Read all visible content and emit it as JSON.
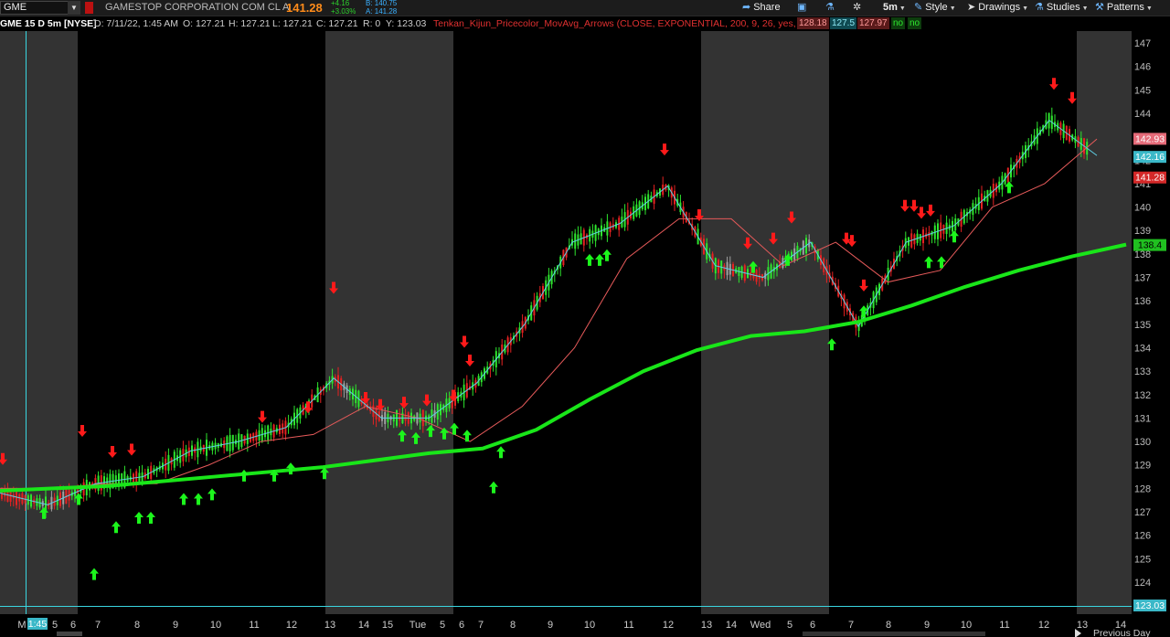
{
  "toolbar": {
    "symbol": "GME",
    "company": "GAMESTOP CORPORATION COM CL A",
    "last_price": "141.28",
    "change_abs": "+4.16",
    "change_pct": "+3.03%",
    "bid": "B: 140.75",
    "ask": "A: 141.28",
    "share_label": "Share",
    "interval_label": "5m",
    "style_label": "Style",
    "drawings_label": "Drawings",
    "studies_label": "Studies",
    "patterns_label": "Patterns"
  },
  "info": {
    "chart_title": "GME 15 D 5m [NYSE]",
    "date": "D: 7/11/22, 1:45 AM",
    "open": "O: 127.21",
    "high": "H: 127.21",
    "low": "L: 127.21",
    "close": "C: 127.21",
    "range": "R: 0",
    "y": "Y: 123.03",
    "study": "Tenkan_Kijun_Pricecolor_MovAvg_Arrows (CLOSE, EXPONENTIAL, 200, 9, 26, yes, yes)",
    "study_val1": "128.18",
    "study_val2": "127.5",
    "study_val3": "127.97",
    "study_flag1": "no",
    "study_flag2": "no"
  },
  "axis": {
    "price_labels": [
      "147",
      "146",
      "145",
      "144",
      "143",
      "142",
      "141",
      "140",
      "139",
      "138",
      "137",
      "136",
      "135",
      "134",
      "133",
      "132",
      "131",
      "130",
      "129",
      "128",
      "127",
      "126",
      "125",
      "124"
    ],
    "tag_kijun": "142.93",
    "tag_tenkan": "142.16",
    "tag_last": "141.28",
    "tag_ma": "138.4",
    "tag_cursor": "123.03",
    "time_labels": [
      "M",
      "1:45",
      "5",
      "6",
      "7",
      "8",
      "9",
      "10",
      "11",
      "12",
      "13",
      "14",
      "15",
      "Tue",
      "5",
      "6",
      "7",
      "8",
      "9",
      "10",
      "11",
      "12",
      "13",
      "14",
      "Wed",
      "5",
      "6",
      "7",
      "8",
      "9",
      "10",
      "11",
      "12",
      "13",
      "14"
    ],
    "time_tail": "Previous Day"
  },
  "colors": {
    "ma": "#19e619",
    "tenkan": "#5fd0e6",
    "kijun": "#e65a5a",
    "up": "#2ee62e",
    "down": "#e62222",
    "neutral": "#a0a0a0",
    "session_shade": "#333333",
    "arrow_up": "#1cf51c",
    "arrow_down": "#ff1a1a"
  },
  "icons": {
    "share": "share-icon",
    "layout": "grid-layout-icon",
    "flask": "flask-icon",
    "settings": "gear-icon",
    "style": "pencil-icon",
    "drawings": "cursor-icon",
    "studies": "flask-icon",
    "patterns": "pattern-icon"
  },
  "chart_data": {
    "type": "line",
    "title": "GME 15 D 5m [NYSE]",
    "xlabel": "",
    "ylabel": "",
    "ylim": [
      123.03,
      147.7
    ],
    "x": [
      "M",
      "5",
      "6",
      "7",
      "8",
      "9",
      "10",
      "11",
      "12",
      "13",
      "14",
      "15",
      "Tue",
      "5",
      "6",
      "7",
      "8",
      "9",
      "10",
      "11",
      "12",
      "13",
      "14",
      "Wed",
      "5",
      "6",
      "7",
      "8",
      "9",
      "10",
      "11",
      "12",
      "13"
    ],
    "series": [
      {
        "values": [
          127.9,
          128.0,
          128.1,
          128.3,
          128.5,
          128.7,
          128.9,
          129.2,
          129.5,
          129.7,
          130.5,
          131.8,
          133.0,
          133.9,
          134.5,
          134.7,
          135.1,
          135.8,
          136.6,
          137.3,
          137.9,
          138.4
        ]
      },
      {
        "values": [
          127.8,
          127.3,
          128.2,
          128.5,
          129.6,
          130.0,
          130.6,
          132.7,
          131.0,
          131.0,
          132.5,
          135.0,
          138.5,
          139.3,
          140.9,
          137.5,
          137.0,
          138.5,
          134.9,
          138.5,
          139.2,
          141.0,
          143.7,
          142.2
        ]
      },
      {
        "values": [
          128.0,
          128.0,
          128.2,
          128.2,
          129.0,
          130.0,
          130.3,
          131.5,
          131.0,
          130.0,
          131.5,
          134.0,
          137.8,
          139.5,
          139.5,
          137.5,
          138.5,
          136.8,
          137.3,
          140.0,
          141.0,
          142.9
        ]
      }
    ],
    "annotations": {
      "buy_arrows": 44,
      "sell_arrows": 30
    },
    "grid": false,
    "legend": "none"
  }
}
